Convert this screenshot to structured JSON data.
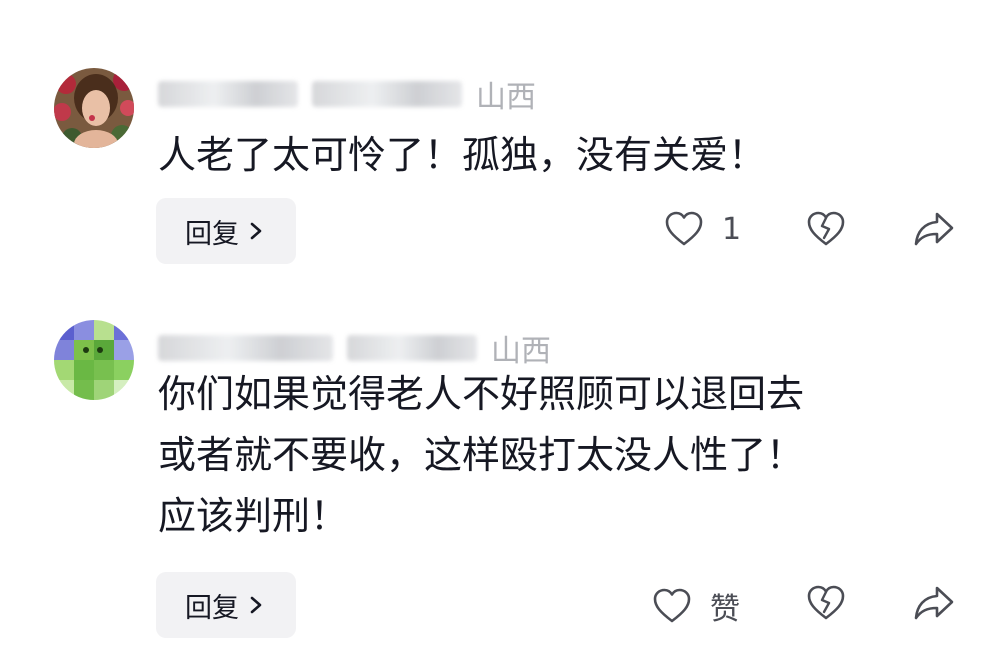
{
  "comments": [
    {
      "location": "山西",
      "text_lines": [
        "人老了太可怜了！孤独，没有关爱！"
      ],
      "reply_label": "回复",
      "like_label": "1",
      "avatar_icon": "woman-photo-avatar"
    },
    {
      "location": "山西",
      "text_lines": [
        "你们如果觉得老人不好照顾可以退回去",
        "或者就不要收，这样殴打太没人性了！",
        "应该判刑！"
      ],
      "reply_label": "回复",
      "like_label": "赞",
      "avatar_icon": "cactus-cartoon-avatar"
    }
  ],
  "colors": {
    "text": "#161823",
    "meta": "#a3a5ab",
    "button_bg": "#f2f2f4",
    "icon": "#4b4d55"
  }
}
